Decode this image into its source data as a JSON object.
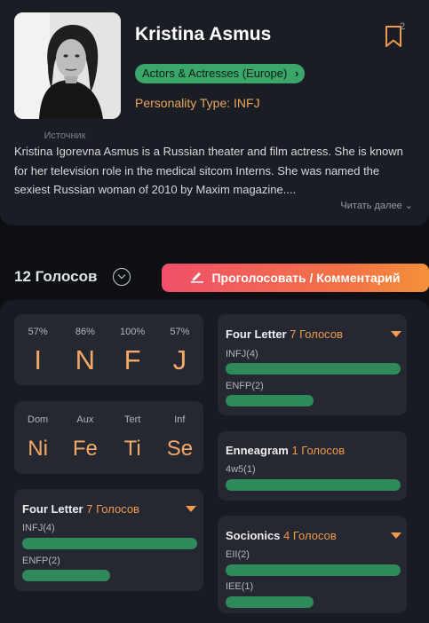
{
  "profile": {
    "name": "Kristina Asmus",
    "bookmark_count": "2",
    "category": "Actors & Actresses (Europe)",
    "personality": "Personality Type: INFJ",
    "source_label": "Источник",
    "bio": "Kristina Igorevna Asmus is a Russian theater and film actress. She is known for her television role in the medical sitcom Interns. She was named the sexiest Russian woman of 2010 by Maxim magazine....",
    "read_more": "Читать далее",
    "avatar_icon": "portrait-photo",
    "bookmark_icon": "bookmark-icon"
  },
  "votes": {
    "count_label": "12 Голосов",
    "vote_button_label": "Проголосовать / Комментарий",
    "vote_button_icon": "pen-icon"
  },
  "type_breakdown": {
    "percents": [
      "57%",
      "86%",
      "100%",
      "57%"
    ],
    "letters": [
      "I",
      "N",
      "F",
      "J"
    ]
  },
  "functions": {
    "labels": [
      "Dom",
      "Aux",
      "Tert",
      "Inf"
    ],
    "values": [
      "Ni",
      "Fe",
      "Ti",
      "Se"
    ]
  },
  "four_letter_left": {
    "title": "Four Letter",
    "count": "7 Голосов",
    "rows": [
      {
        "label": "INFJ(4)",
        "value": 4
      },
      {
        "label": "ENFP(2)",
        "value": 2
      }
    ]
  },
  "four_letter_right": {
    "title": "Four Letter",
    "count": "7 Голосов",
    "rows": [
      {
        "label": "INFJ(4)",
        "value": 4
      },
      {
        "label": "ENFP(2)",
        "value": 2
      }
    ]
  },
  "enneagram": {
    "title": "Enneagram",
    "count": "1 Голосов",
    "rows": [
      {
        "label": "4w5(1)",
        "value": 1
      }
    ]
  },
  "socionics": {
    "title": "Socionics",
    "count": "4 Голосов",
    "rows": [
      {
        "label": "EII(2)",
        "value": 2
      },
      {
        "label": "IEE(1)",
        "value": 1
      }
    ]
  },
  "colors": {
    "accent_orange": "#f4a867",
    "tag_green": "#3aa66a",
    "bar_green": "#2f8a5b",
    "button_gradient_start": "#f0506a",
    "button_gradient_end": "#f4913a"
  }
}
